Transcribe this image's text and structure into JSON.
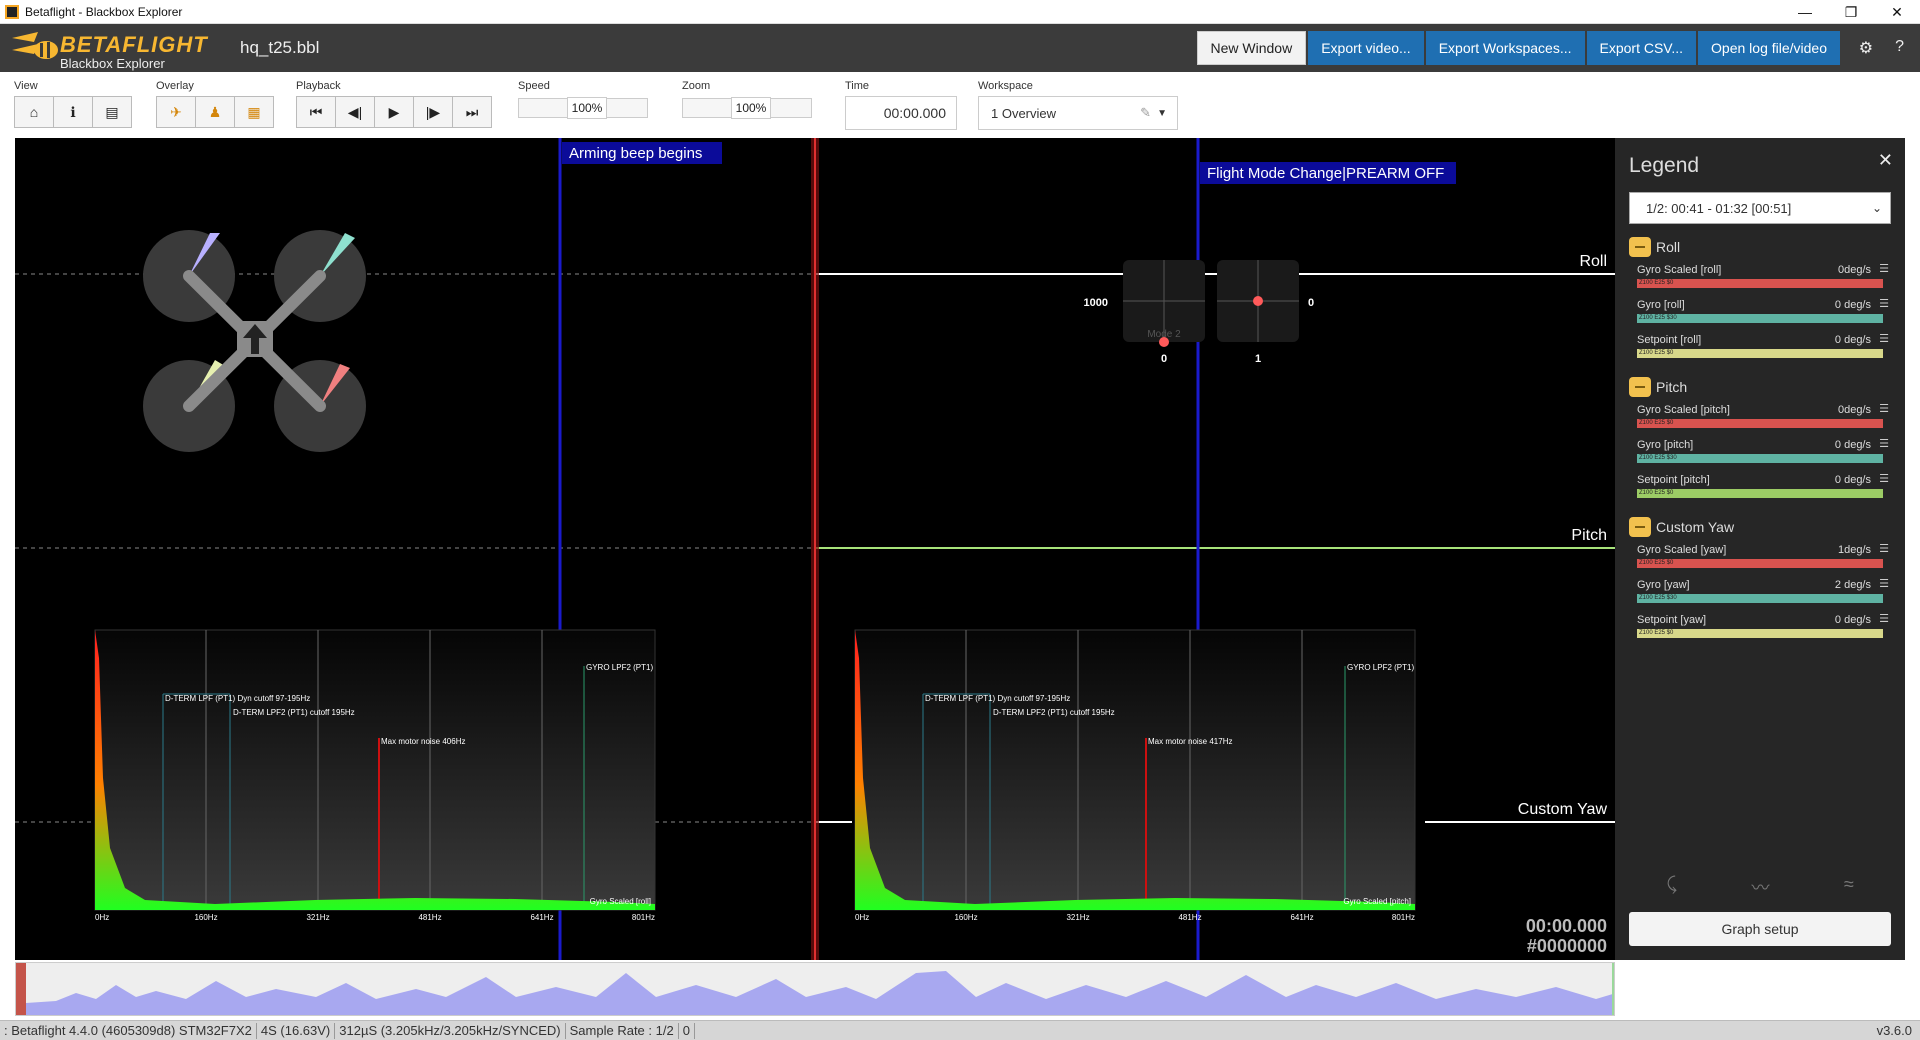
{
  "window": {
    "title": "Betaflight - Blackbox Explorer",
    "minimize": "—",
    "maximize": "❐",
    "close": "✕"
  },
  "header": {
    "brand": "BETAFLIGHT",
    "brand_sub": "Blackbox Explorer",
    "filename": "hq_t25.bbl",
    "buttons": {
      "new_window": "New Window",
      "export_video": "Export video...",
      "export_workspaces": "Export Workspaces...",
      "export_csv": "Export CSV...",
      "open_log": "Open log file/video"
    },
    "settings_icon": "gear-icon",
    "help_icon": "help-icon"
  },
  "toolbar": {
    "view_label": "View",
    "overlay_label": "Overlay",
    "playback_label": "Playback",
    "speed_label": "Speed",
    "speed_value": "100%",
    "zoom_label": "Zoom",
    "zoom_value": "100%",
    "time_label": "Time",
    "time_value": "00:00.000",
    "workspace_label": "Workspace",
    "workspace_value": "1  Overview"
  },
  "graph": {
    "event_arming": "Arming beep begins",
    "event_flightmode": "Flight Mode Change|PREARM OFF",
    "axis_roll": "Roll",
    "axis_pitch": "Pitch",
    "axis_yaw": "Custom Yaw",
    "stick_left_label": "1000",
    "stick_right_label": "0",
    "stick_mode": "Mode 2",
    "stick_left_bottom": "0",
    "stick_right_bottom": "1",
    "time_readout": "00:00.000",
    "frame_readout": "#0000000",
    "colors": {
      "roll_line": "#ffffff",
      "pitch_line": "#a7e37a",
      "event_bar": "#1a1acc",
      "cursor": "#cc2222"
    }
  },
  "spectrum_left": {
    "dterm_lpf": "D-TERM LPF (PT1) Dyn cutoff 97-195Hz",
    "dterm_lpf2": "D-TERM LPF2 (PT1) cutoff 195Hz",
    "max_noise": "Max motor noise 406Hz",
    "gyro_lpf2": "GYRO LPF2 (PT1)",
    "source": "Gyro Scaled [roll]",
    "ticks": [
      "0Hz",
      "160Hz",
      "321Hz",
      "481Hz",
      "641Hz",
      "801Hz"
    ]
  },
  "spectrum_right": {
    "dterm_lpf": "D-TERM LPF (PT1) Dyn cutoff 97-195Hz",
    "dterm_lpf2": "D-TERM LPF2 (PT1) cutoff 195Hz",
    "max_noise": "Max motor noise 417Hz",
    "gyro_lpf2": "GYRO LPF2 (PT1)",
    "source": "Gyro Scaled [pitch]",
    "ticks": [
      "0Hz",
      "160Hz",
      "321Hz",
      "481Hz",
      "641Hz",
      "801Hz"
    ]
  },
  "legend": {
    "title": "Legend",
    "close": "✕",
    "range": "1/2: 00:41 - 01:32 [00:51]",
    "groups": [
      {
        "title": "Roll",
        "fields": [
          {
            "name": "Gyro Scaled [roll]",
            "value": "0deg/s",
            "bar": "Z100 E25 $0",
            "color": "#d9534f"
          },
          {
            "name": "Gyro [roll]",
            "value": "0 deg/s",
            "bar": "Z100 E25 $30",
            "color": "#5fb3a3"
          },
          {
            "name": "Setpoint [roll]",
            "value": "0 deg/s",
            "bar": "Z100 E25 $0",
            "color": "#d8d88a"
          }
        ]
      },
      {
        "title": "Pitch",
        "fields": [
          {
            "name": "Gyro Scaled [pitch]",
            "value": "0deg/s",
            "bar": "Z100 E25 $0",
            "color": "#d9534f"
          },
          {
            "name": "Gyro [pitch]",
            "value": "0 deg/s",
            "bar": "Z100 E25 $30",
            "color": "#5fb3a3"
          },
          {
            "name": "Setpoint [pitch]",
            "value": "0 deg/s",
            "bar": "Z100 E25 $0",
            "color": "#9ccc65"
          }
        ]
      },
      {
        "title": "Custom Yaw",
        "fields": [
          {
            "name": "Gyro Scaled [yaw]",
            "value": "1deg/s",
            "bar": "Z100 E25 $0",
            "color": "#d9534f"
          },
          {
            "name": "Gyro [yaw]",
            "value": "2 deg/s",
            "bar": "Z100 E25 $30",
            "color": "#5fb3a3"
          },
          {
            "name": "Setpoint [yaw]",
            "value": "0 deg/s",
            "bar": "Z100 E25 $0",
            "color": "#d8d88a"
          }
        ]
      }
    ],
    "graph_setup": "Graph setup"
  },
  "statusbar": {
    "firmware": ": Betaflight 4.4.0 (4605309d8) STM32F7X2",
    "battery": "4S (16.63V)",
    "looptime": "312µS (3.205kHz/3.205kHz/SYNCED)",
    "sample_rate": "Sample Rate : 1/2",
    "count": "0",
    "version": "v3.6.0"
  }
}
